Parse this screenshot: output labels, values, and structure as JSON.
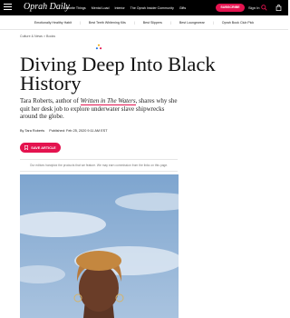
{
  "header": {
    "logo_text": "Oprah Daily",
    "nav": [
      "Favorite Things",
      "Mental Load",
      "Interior",
      "The Oprah Insider Community",
      "Gifts"
    ],
    "subscribe_label": "SUBSCRIBE",
    "signin_label": "Sign In",
    "icons": [
      "menu-icon",
      "search-icon",
      "shopping-bag-icon"
    ],
    "colors": {
      "bar": "#000000",
      "accent": "#e4134f"
    }
  },
  "subnav": {
    "items": [
      "Emotionally Healthy Habit",
      "Best Teeth Whitening Kits",
      "Best Slippers",
      "Best Loungewear",
      "Oprah Book Club Pick"
    ],
    "separator": "|"
  },
  "article": {
    "breadcrumb": "Culture & News > Books",
    "title": "Diving Deep Into Black History",
    "dek_before": "Tara Roberts, author of ",
    "dek_book": "Written in The Waters",
    "dek_after": ", shares why she quit her desk job to explore underwater slave shipwrecks around the globe.",
    "byline": "By Tara Roberts",
    "published": "Published: Feb 25, 2020 9:11 AM EST",
    "save_label": "SAVE ARTICLE",
    "disclosure": "Our editors handpick the products that we feature. We may earn commission from the links on this page."
  }
}
